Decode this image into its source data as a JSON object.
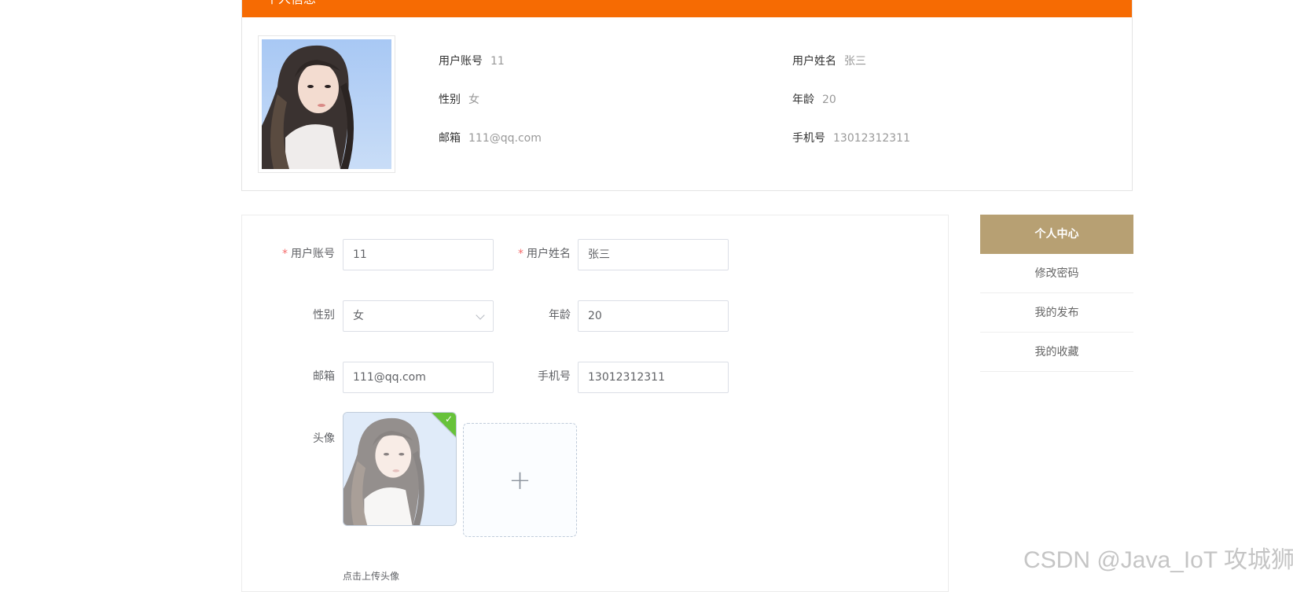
{
  "profile": {
    "header_title": "个人信息",
    "fields": {
      "account_label": "用户账号",
      "account_value": "11",
      "name_label": "用户姓名",
      "name_value": "张三",
      "gender_label": "性别",
      "gender_value": "女",
      "age_label": "年龄",
      "age_value": "20",
      "email_label": "邮箱",
      "email_value": "111@qq.com",
      "phone_label": "手机号",
      "phone_value": "13012312311"
    }
  },
  "form": {
    "required_mark": "*",
    "account_label": "用户账号",
    "account_value": "11",
    "name_label": "用户姓名",
    "name_value": "张三",
    "gender_label": "性别",
    "gender_value": "女",
    "age_label": "年龄",
    "age_value": "20",
    "email_label": "邮箱",
    "email_value": "111@qq.com",
    "phone_label": "手机号",
    "phone_value": "13012312311",
    "avatar_label": "头像",
    "upload_plus": "+",
    "upload_success_check": "✓",
    "upload_tip": "点击上传头像"
  },
  "side_menu": {
    "items": [
      {
        "label": "个人中心",
        "active": true
      },
      {
        "label": "修改密码",
        "active": false
      },
      {
        "label": "我的发布",
        "active": false
      },
      {
        "label": "我的收藏",
        "active": false
      }
    ]
  },
  "watermark": "CSDN @Java_IoT 攻城狮",
  "colors": {
    "header_orange": "#f66b03",
    "menu_active": "#b7a073",
    "required_red": "#f56c6c",
    "success_green": "#67c23a"
  },
  "icons": [
    "select-chevron-down-icon",
    "upload-success-check-icon",
    "upload-plus-icon"
  ]
}
